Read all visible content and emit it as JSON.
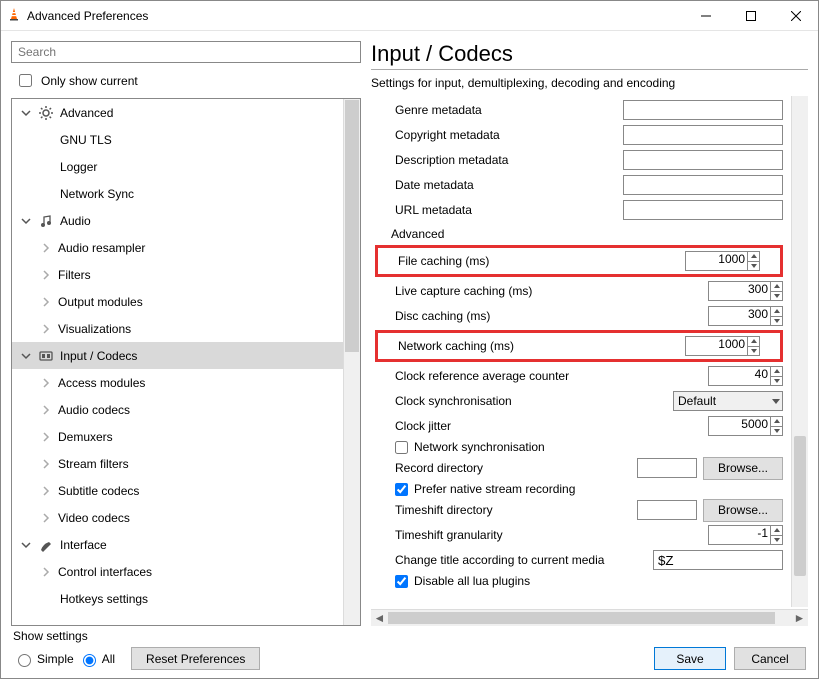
{
  "window": {
    "title": "Advanced Preferences"
  },
  "search": {
    "placeholder": "Search"
  },
  "only_show_current": {
    "label": "Only show current",
    "checked": false
  },
  "tree": {
    "advanced": "Advanced",
    "gnu_tls": "GNU TLS",
    "logger": "Logger",
    "network_sync": "Network Sync",
    "audio": "Audio",
    "audio_resampler": "Audio resampler",
    "filters": "Filters",
    "output_modules": "Output modules",
    "visualizations": "Visualizations",
    "input_codecs": "Input / Codecs",
    "access_modules": "Access modules",
    "audio_codecs": "Audio codecs",
    "demuxers": "Demuxers",
    "stream_filters": "Stream filters",
    "subtitle_codecs": "Subtitle codecs",
    "video_codecs": "Video codecs",
    "interface": "Interface",
    "control_interfaces": "Control interfaces",
    "hotkeys_settings": "Hotkeys settings"
  },
  "panel": {
    "title": "Input / Codecs",
    "description": "Settings for input, demultiplexing, decoding and encoding"
  },
  "meta": {
    "genre": {
      "label": "Genre metadata",
      "value": ""
    },
    "copyright": {
      "label": "Copyright metadata",
      "value": ""
    },
    "description": {
      "label": "Description metadata",
      "value": ""
    },
    "date": {
      "label": "Date metadata",
      "value": ""
    },
    "url": {
      "label": "URL metadata",
      "value": ""
    }
  },
  "advanced_section": {
    "title": "Advanced",
    "file_caching": {
      "label": "File caching (ms)",
      "value": "1000"
    },
    "live_capture_caching": {
      "label": "Live capture caching (ms)",
      "value": "300"
    },
    "disc_caching": {
      "label": "Disc caching (ms)",
      "value": "300"
    },
    "network_caching": {
      "label": "Network caching (ms)",
      "value": "1000"
    },
    "clock_ref_avg": {
      "label": "Clock reference average counter",
      "value": "40"
    },
    "clock_sync": {
      "label": "Clock synchronisation",
      "value": "Default"
    },
    "clock_jitter": {
      "label": "Clock jitter",
      "value": "5000"
    },
    "network_sync": {
      "label": "Network synchronisation",
      "checked": false
    },
    "record_dir": {
      "label": "Record directory",
      "value": "",
      "browse": "Browse..."
    },
    "prefer_native": {
      "label": "Prefer native stream recording",
      "checked": true
    },
    "timeshift_dir": {
      "label": "Timeshift directory",
      "value": "",
      "browse": "Browse..."
    },
    "timeshift_granularity": {
      "label": "Timeshift granularity",
      "value": "-1"
    },
    "change_title": {
      "label": "Change title according to current media",
      "value": "$Z"
    },
    "disable_lua": {
      "label": "Disable all lua plugins",
      "checked": true
    }
  },
  "footer": {
    "show_settings": "Show settings",
    "simple": "Simple",
    "all": "All",
    "reset": "Reset Preferences",
    "save": "Save",
    "cancel": "Cancel"
  }
}
